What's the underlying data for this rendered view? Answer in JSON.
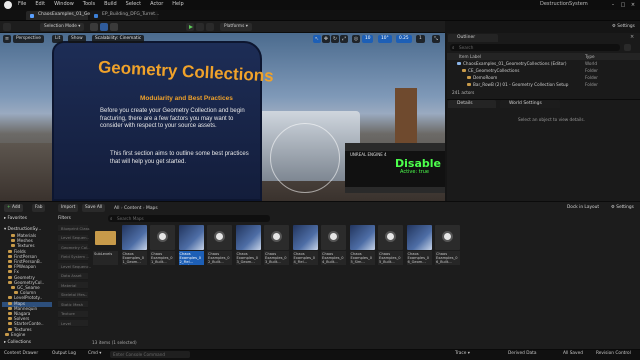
{
  "titlebar": {
    "menu": [
      "File",
      "Edit",
      "Window",
      "Tools",
      "Build",
      "Select",
      "Actor",
      "Help"
    ],
    "window_title": "DestructionSystem"
  },
  "tabs": [
    {
      "label": "ChaosExamples_01_Ge...",
      "active": true
    },
    {
      "label": "EP_Building_DFG_Turret..."
    }
  ],
  "toolbar": {
    "mode_label": "Selection Mode",
    "platforms_label": "Platforms",
    "settings_label": "Settings"
  },
  "viewport": {
    "perspective_label": "Perspective",
    "lit_label": "Lit",
    "show_label": "Show",
    "scalability_label": "Scalability: Cinematic",
    "snap_value": "10",
    "rot_value": "10°",
    "scale_value": "0.25",
    "camera_speed": "1",
    "billboard": {
      "title": "Geometry Collections",
      "subtitle": "Modularity and Best Practices",
      "para1": "Before you create your Geometry Collection and begin fracturing, there are a few factors you may want to consider with respect to your source assets.",
      "para2": "This first section aims to outline some best practices that will help you get started."
    },
    "sign": {
      "top": "UNREAL ENGINE 4",
      "big": "Disable",
      "small": "Active: true"
    }
  },
  "outliner": {
    "title": "Outliner",
    "search_placeholder": "Search",
    "col_label": "Item Label",
    "col_type": "Type",
    "rows": [
      {
        "label": "ChaosExamples_01_GeometryCollections (Editor)",
        "type": "World",
        "indent": 0
      },
      {
        "label": "CE_GeometryCollections",
        "type": "Folder",
        "indent": 1
      },
      {
        "label": "DemoRoom",
        "type": "Folder",
        "indent": 2
      },
      {
        "label": "Bar_RowB (2) 01 - Geometry Collection Setup",
        "type": "Folder",
        "indent": 2
      }
    ],
    "actor_count": "241 actors"
  },
  "details": {
    "tab_details": "Details",
    "tab_world": "World Settings",
    "empty_message": "Select an object to view details."
  },
  "content_browser": {
    "add_label": "Add",
    "fab_label": "Fab",
    "import_label": "Import",
    "save_all_label": "Save All",
    "breadcrumb": [
      "All",
      "Content",
      "Maps"
    ],
    "search_placeholder": "Search Maps",
    "dock_label": "Dock in Layout",
    "settings_label": "Settings",
    "favorites_label": "Favorites",
    "project_label": "DestructionSy...",
    "filters_label": "Filters",
    "collections_label": "Collections",
    "tree": [
      {
        "label": "Materials",
        "indent": 3
      },
      {
        "label": "Meshes",
        "indent": 3
      },
      {
        "label": "Textures",
        "indent": 3
      },
      {
        "label": "Fields",
        "indent": 2
      },
      {
        "label": "FirstPerson",
        "indent": 2
      },
      {
        "label": "FirstPersonB..",
        "indent": 2
      },
      {
        "label": "FPWeapon",
        "indent": 2
      },
      {
        "label": "Fx",
        "indent": 2
      },
      {
        "label": "Geometry",
        "indent": 2
      },
      {
        "label": "GeometryCol..",
        "indent": 2
      },
      {
        "label": "GC_Seame",
        "indent": 3
      },
      {
        "label": "Column",
        "indent": 4
      },
      {
        "label": "LevelPrototy..",
        "indent": 2
      },
      {
        "label": "Maps",
        "indent": 2,
        "selected": true
      },
      {
        "label": "Mannequin",
        "indent": 2
      },
      {
        "label": "Niagara",
        "indent": 2
      },
      {
        "label": "Solvers",
        "indent": 2
      },
      {
        "label": "StarterConte..",
        "indent": 2
      },
      {
        "label": "Textures",
        "indent": 2
      },
      {
        "label": "Engine",
        "indent": 1
      }
    ],
    "filters": [
      "Blueprint Class",
      "Level Sequen..",
      "Geometry Col..",
      "Field System ..",
      "Level Sequenc..",
      "Data Asset",
      "Material",
      "Skeletal Mes..",
      "Static Mesh",
      "Texture",
      "Level"
    ],
    "assets": [
      {
        "label": "SubLevels",
        "kind": "folder"
      },
      {
        "label": "Chaos Examples_0 1_Geom...",
        "kind": "map"
      },
      {
        "label": "Chaos Examples_0 1_Built...",
        "kind": "data"
      },
      {
        "label": "Chaos Examples_0 2_Fiel... Level",
        "kind": "map",
        "selected": true
      },
      {
        "label": "Chaos Examples_0 2_Built...",
        "kind": "data"
      },
      {
        "label": "Chaos Examples_0 3_Geom...",
        "kind": "map"
      },
      {
        "label": "Chaos Examples_0 3_Built...",
        "kind": "data"
      },
      {
        "label": "Chaos Examples_0 4_Fiel...",
        "kind": "map"
      },
      {
        "label": "Chaos Examples_0 4_Built...",
        "kind": "data"
      },
      {
        "label": "Chaos Examples_0 5_Sim...",
        "kind": "map"
      },
      {
        "label": "Chaos Examples_0 5_Built...",
        "kind": "data"
      },
      {
        "label": "Chaos Examples_0 6_Geom...",
        "kind": "map"
      },
      {
        "label": "Chaos Examples_0 6_Built...",
        "kind": "data"
      }
    ],
    "item_count": "13 items (1 selected)"
  },
  "statusbar": {
    "content_drawer": "Content Drawer",
    "output_log": "Output Log",
    "cmd": "Cmd",
    "console_placeholder": "Enter Console Command",
    "trace": "Trace",
    "derived_data": "Derived Data",
    "all_saved": "All Saved",
    "revision_control": "Revision Control"
  },
  "colors": {
    "accent": "#1d5fb6",
    "folder": "#c79a4a",
    "billboard_text": "#f0a22a",
    "sign_green": "#4cff4c"
  }
}
